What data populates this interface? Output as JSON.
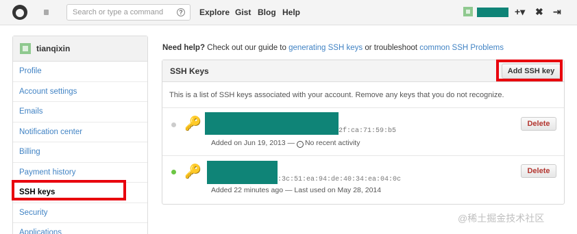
{
  "header": {
    "search_placeholder": "Search or type a command",
    "help_glyph": "?",
    "nav": [
      "Explore",
      "Gist",
      "Blog",
      "Help"
    ],
    "icons": [
      "github-logo",
      "repo-icon",
      "plus-icon",
      "tools-icon",
      "logout-icon"
    ],
    "plus": "+▾",
    "tools": "✖",
    "logout": "⇥"
  },
  "sidebar": {
    "username": "tianqixin",
    "items": [
      {
        "label": "Profile"
      },
      {
        "label": "Account settings"
      },
      {
        "label": "Emails"
      },
      {
        "label": "Notification center"
      },
      {
        "label": "Billing"
      },
      {
        "label": "Payment history"
      },
      {
        "label": "SSH keys",
        "selected": true
      },
      {
        "label": "Security"
      },
      {
        "label": "Applications"
      }
    ]
  },
  "help": {
    "lead": "Need help?",
    "text1": " Check out our guide to ",
    "link1": "generating SSH keys",
    "text2": " or troubleshoot ",
    "link2": "common SSH Problems"
  },
  "ssh": {
    "title": "SSH Keys",
    "add_label": "Add SSH key",
    "description": "This is a list of SSH keys associated with your account. Remove any keys that you do not recognize.",
    "keys": [
      {
        "fingerprint_tail": "2f:ca:71:59:b5",
        "added": "Added on Jun 19, 2013 —",
        "usage": "No recent activity",
        "active": false,
        "delete_label": "Delete"
      },
      {
        "fingerprint_tail": ":3c:51:ea:94:de:40:34:ea:04:0c",
        "added": "Added 22 minutes ago — Last used on May 28, 2014",
        "usage": "",
        "active": true,
        "delete_label": "Delete"
      }
    ]
  },
  "colors": {
    "accent_link": "#4183c4",
    "highlight_box": "#e8000d",
    "redaction": "#0f8477",
    "active_dot": "#6cc644",
    "inactive_dot": "#cccccc"
  },
  "watermark": "@稀土掘金技术社区"
}
